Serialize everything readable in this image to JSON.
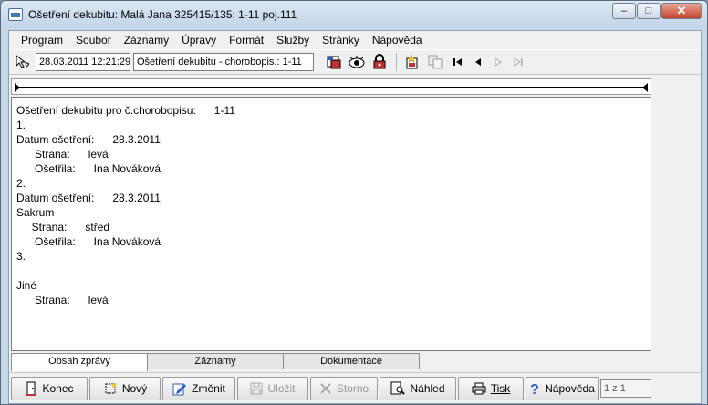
{
  "window": {
    "title": "Ošetření dekubitu: Malá Jana 325415/135: 1-11 poj.111"
  },
  "menu": [
    "Program",
    "Soubor",
    "Záznamy",
    "Úpravy",
    "Formát",
    "Služby",
    "Stránky",
    "Nápověda"
  ],
  "toolbar": {
    "datetime": "28.03.2011 12:21:29",
    "record": "Ošetření dekubitu - chorobopis.: 1-11"
  },
  "document": {
    "lines": [
      "Ošetření dekubitu pro č.chorobopisu:      1-11",
      "1.",
      "Datum ošetření:      28.3.2011",
      "      Strana:      levá",
      "      Ošetřila:      Ina Nováková",
      "2.",
      "Datum ošetření:      28.3.2011",
      "Sakrum",
      "     Strana:      střed",
      "      Ošetřila:      Ina Nováková",
      "3.",
      "",
      "Jiné",
      "      Strana:      levá"
    ]
  },
  "tabs": [
    "Obsah zprávy",
    "Záznamy",
    "Dokumentace"
  ],
  "buttons": {
    "konec": "Konec",
    "novy": "Nový",
    "zmenit": "Změnit",
    "ulozit": "Uložit",
    "storno": "Storno",
    "nahled": "Náhled",
    "tisk": "Tisk",
    "napoveda": "Nápověda"
  },
  "counter": "1 z 1",
  "colors": {
    "accent": "#3b78c0",
    "close": "#c4432a"
  }
}
